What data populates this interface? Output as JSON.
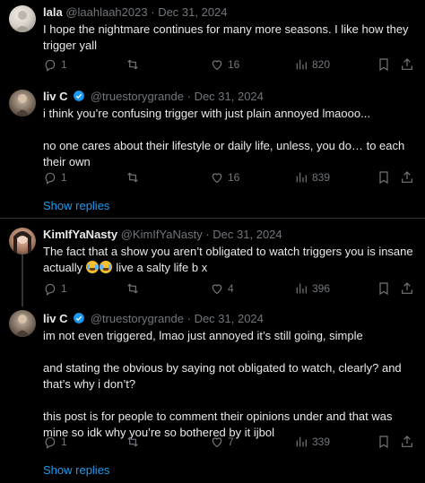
{
  "posts": [
    {
      "name": "lala",
      "handle": "@laahlaah2023",
      "sep": "·",
      "date": "Dec 31, 2024",
      "verified": false,
      "paragraphs": [
        "I hope the nightmare continues for many more seasons. I like how they trigger yall"
      ],
      "replies": "1",
      "reposts": "",
      "likes": "16",
      "views": "820"
    },
    {
      "name": "liv C",
      "handle": "@truestorygrande",
      "sep": "·",
      "date": "Dec 31, 2024",
      "verified": true,
      "paragraphs": [
        "i think you’re confusing trigger with just plain annoyed lmaooo...",
        "no one cares about their lifestyle or daily life, unless, you do… to each their own"
      ],
      "replies": "1",
      "reposts": "",
      "likes": "16",
      "views": "839"
    },
    {
      "name": "KimIfYaNasty",
      "handle": "@KimIfYaNasty",
      "sep": "·",
      "date": "Dec 31, 2024",
      "verified": false,
      "paragraphs": [
        "The fact that a show you aren’t obligated to watch triggers you is insane actually",
        "live a salty life b x"
      ],
      "replies": "1",
      "reposts": "",
      "likes": "4",
      "views": "396"
    },
    {
      "name": "liv C",
      "handle": "@truestorygrande",
      "sep": "·",
      "date": "Dec 31, 2024",
      "verified": true,
      "paragraphs": [
        "im not even triggered, lmao just annoyed it’s still going, simple",
        "and stating the obvious by saying not obligated to watch, clearly? and that’s why i don’t?",
        "this post is for people to comment their opinions under and that was mine so idk why you’re so bothered by it ijbol"
      ],
      "replies": "1",
      "reposts": "",
      "likes": "7",
      "views": "339"
    }
  ],
  "show_replies_label": "Show replies",
  "colors": {
    "background": "#000000",
    "text": "#e7e9ea",
    "muted": "#71767b",
    "link": "#1d9bf0",
    "verified": "#1d9bf0",
    "divider": "#2f3336"
  },
  "icons": [
    "reply-icon",
    "repost-icon",
    "like-icon",
    "views-icon",
    "bookmark-icon",
    "share-icon",
    "verified-badge-icon"
  ]
}
